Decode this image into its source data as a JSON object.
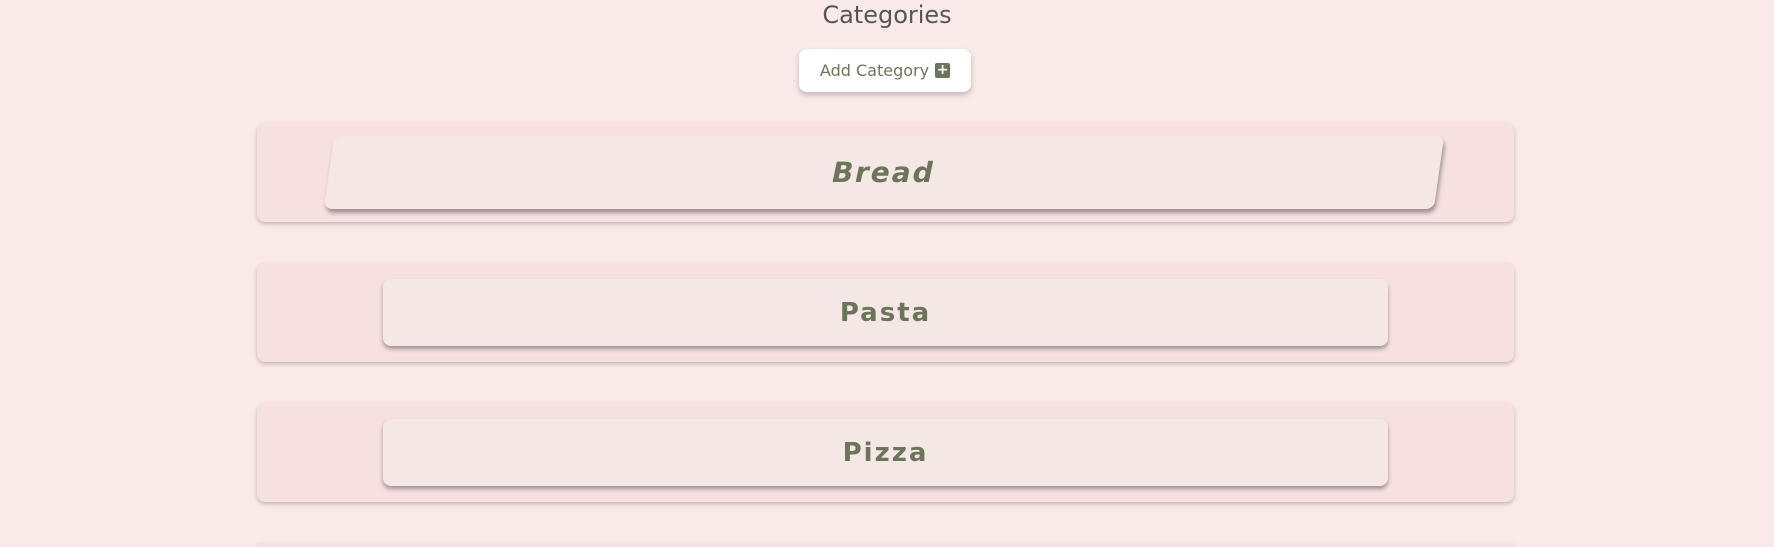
{
  "page": {
    "title": "Categories"
  },
  "add_button": {
    "label": "Add Category",
    "icon": "plus-square-icon"
  },
  "categories": [
    {
      "label": "Bread"
    },
    {
      "label": "Pasta"
    },
    {
      "label": "Pizza"
    },
    {
      "label": ""
    }
  ],
  "colors": {
    "background": "#fae9e9",
    "card": "#f6e0e1",
    "card_inner": "#f6e7e7",
    "accent": "#6b7658",
    "title_text": "#565656",
    "button_bg": "#ffffff"
  }
}
